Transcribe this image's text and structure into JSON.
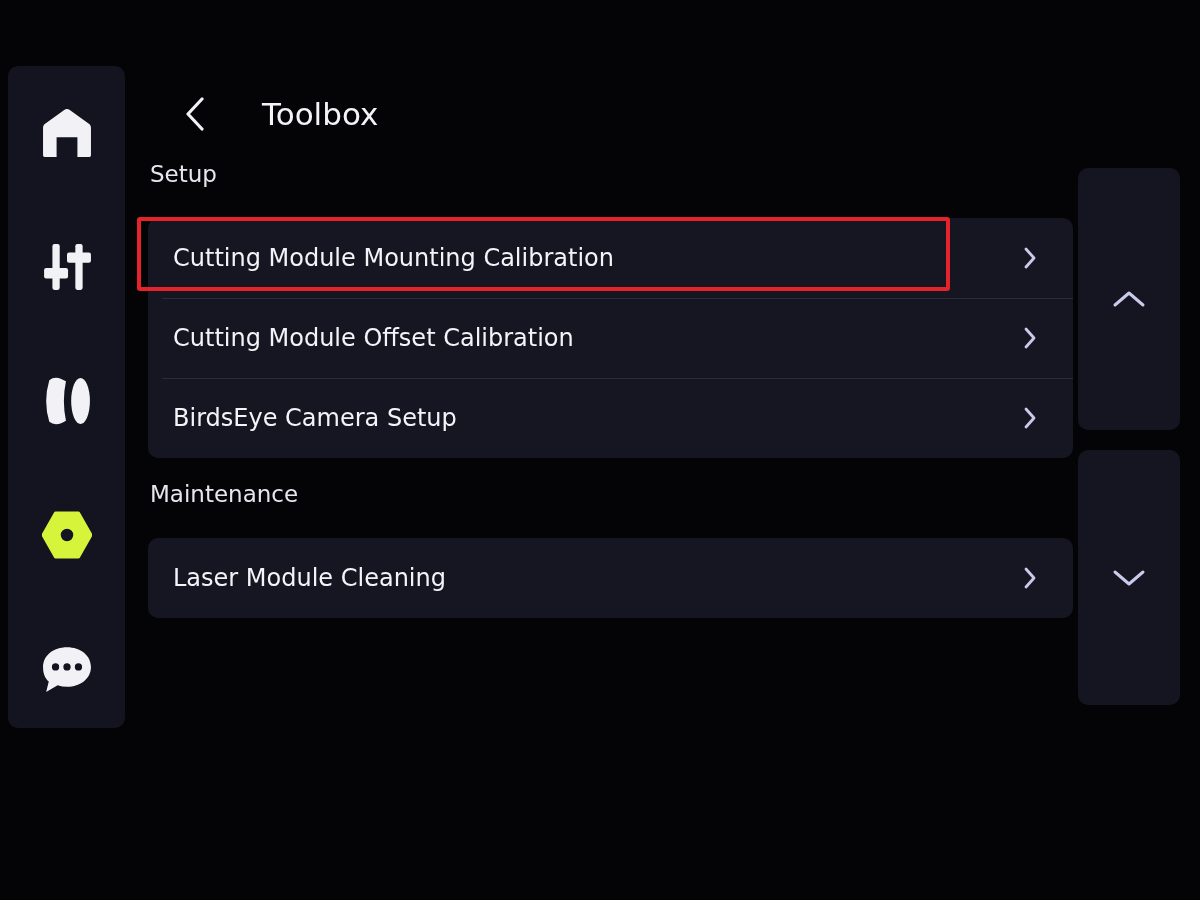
{
  "sidebar": {
    "items": [
      {
        "selected": false
      },
      {
        "selected": false
      },
      {
        "selected": false
      },
      {
        "selected": true
      },
      {
        "selected": false
      }
    ]
  },
  "header": {
    "title": "Toolbox"
  },
  "sections": [
    {
      "heading": "Setup",
      "items": [
        {
          "label": "Cutting Module Mounting Calibration",
          "highlighted": true
        },
        {
          "label": "Cutting Module Offset Calibration",
          "highlighted": false
        },
        {
          "label": "BirdsEye Camera Setup",
          "highlighted": false
        }
      ]
    },
    {
      "heading": "Maintenance",
      "items": [
        {
          "label": "Laser Module Cleaning",
          "highlighted": false
        }
      ]
    }
  ]
}
